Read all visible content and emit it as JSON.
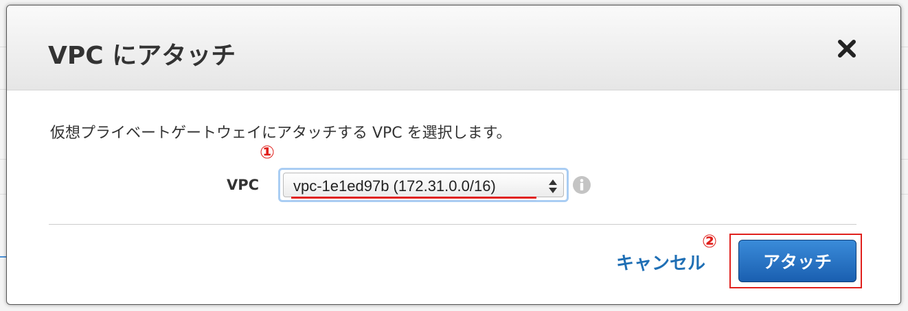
{
  "dialog": {
    "title": "VPC にアタッチ",
    "close_icon": "close-icon",
    "description": "仮想プライベートゲートウェイにアタッチする VPC を選択します。",
    "vpc_field": {
      "label": "VPC",
      "selected_value": "vpc-1e1ed97b (172.31.0.0/16)",
      "info_icon": "info-icon"
    },
    "cancel_label": "キャンセル",
    "attach_label": "アタッチ"
  },
  "annotations": {
    "marker_1": "①",
    "marker_2": "②",
    "color": "#e0201c"
  },
  "colors": {
    "primary_button": "#1a5fb0",
    "link": "#1f6fb5",
    "focus_ring": "#a9cdf3"
  }
}
